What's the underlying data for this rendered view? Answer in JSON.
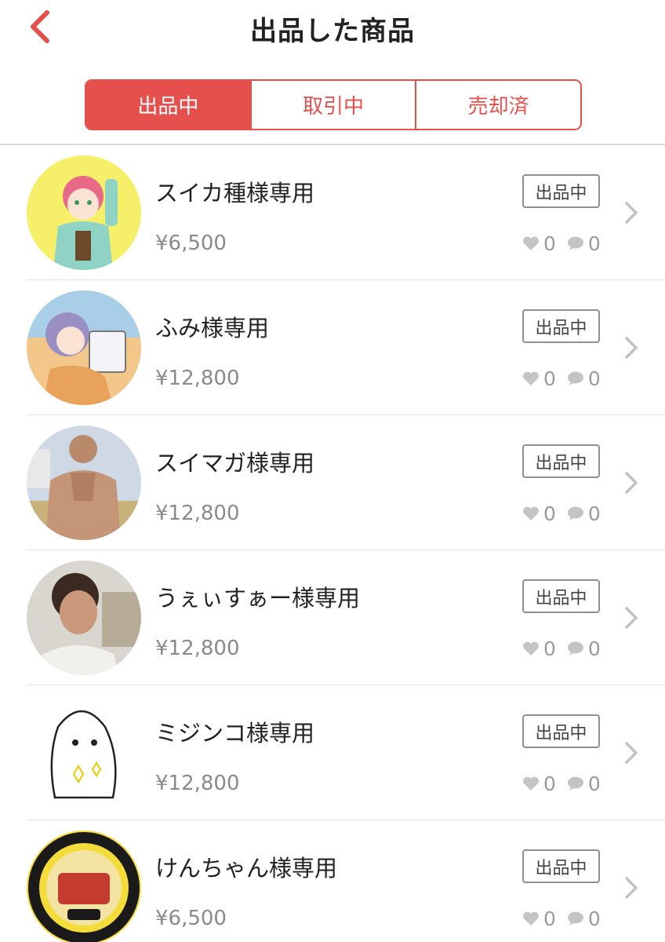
{
  "header": {
    "title": "出品した商品",
    "back_icon": "chevron-left-icon",
    "accent": "#e5504c"
  },
  "tabs": [
    {
      "label": "出品中",
      "active": true
    },
    {
      "label": "取引中",
      "active": false
    },
    {
      "label": "売却済",
      "active": false
    }
  ],
  "items": [
    {
      "title": "スイカ種様専用",
      "price": "¥6,500",
      "status": "出品中",
      "likes": "0",
      "comments": "0"
    },
    {
      "title": "ふみ様専用",
      "price": "¥12,800",
      "status": "出品中",
      "likes": "0",
      "comments": "0"
    },
    {
      "title": "スイマガ様専用",
      "price": "¥12,800",
      "status": "出品中",
      "likes": "0",
      "comments": "0"
    },
    {
      "title": "うぇぃすぁー様専用",
      "price": "¥12,800",
      "status": "出品中",
      "likes": "0",
      "comments": "0"
    },
    {
      "title": "ミジンコ様専用",
      "price": "¥12,800",
      "status": "出品中",
      "likes": "0",
      "comments": "0"
    },
    {
      "title": "けんちゃん様専用",
      "price": "¥6,500",
      "status": "出品中",
      "likes": "0",
      "comments": "0"
    }
  ]
}
